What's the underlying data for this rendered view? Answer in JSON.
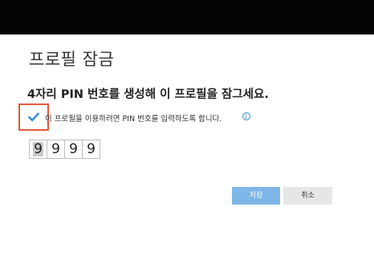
{
  "page": {
    "title": "프로필 잠금",
    "heading": "4자리 PIN 번호를 생성해 이 프로필을 잠그세요."
  },
  "lock_option": {
    "checked": true,
    "label": "이 프로필을 이용하려면 PIN 번호를 입력하도록 합니다.",
    "info_icon": "info-circle-icon"
  },
  "pin": {
    "digits": [
      "9",
      "9",
      "9",
      "9"
    ]
  },
  "buttons": {
    "save_label": "저장",
    "cancel_label": "취소"
  },
  "colors": {
    "top_bar": "#050505",
    "highlight_border": "#e25a3a",
    "checkbox_accent": "#2f87d8",
    "save_button": "#7eb6e8",
    "cancel_button": "#e6e6e6"
  }
}
